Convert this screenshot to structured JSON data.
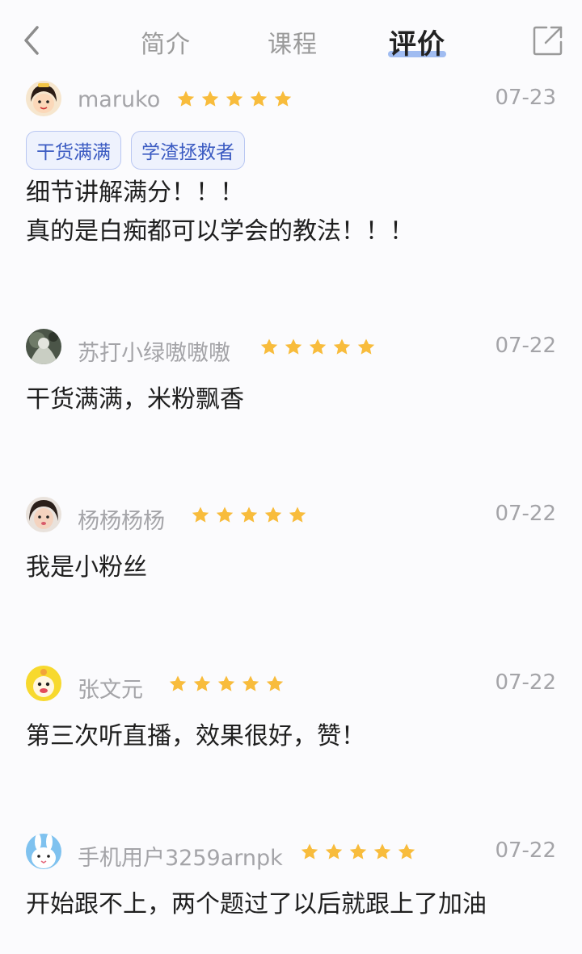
{
  "header": {
    "tabs": [
      {
        "label": "简介"
      },
      {
        "label": "课程"
      },
      {
        "label": "评价"
      }
    ],
    "active_tab": "评价"
  },
  "colors": {
    "accent": "#8fb0ef",
    "star": "#f8bc3c",
    "tag_border": "#b9c7f2",
    "tag_text": "#3b5bc2"
  },
  "reviews": [
    {
      "username": "maruko",
      "rating": 5,
      "date": "07-23",
      "tags": [
        "干货满满",
        "学渣拯救者"
      ],
      "content": "细节讲解满分！！！\n真的是白痴都可以学会的教法！！！",
      "avatar_icon": "cartoon-girl-avatar"
    },
    {
      "username": "苏打小绿嗷嗷嗷",
      "rating": 5,
      "date": "07-22",
      "tags": [],
      "content": "干货满满，米粉飘香",
      "avatar_icon": "photo-avatar"
    },
    {
      "username": "杨杨杨杨",
      "rating": 5,
      "date": "07-22",
      "tags": [],
      "content": "我是小粉丝",
      "avatar_icon": "child-photo-avatar"
    },
    {
      "username": "张文元",
      "rating": 5,
      "date": "07-22",
      "tags": [],
      "content": "第三次听直播，效果很好，赞！",
      "avatar_icon": "yellow-character-avatar"
    },
    {
      "username": "手机用户3259arnpk",
      "rating": 5,
      "date": "07-22",
      "tags": [],
      "content": "开始跟不上，两个题过了以后就跟上了加油",
      "avatar_icon": "bunny-avatar"
    }
  ]
}
